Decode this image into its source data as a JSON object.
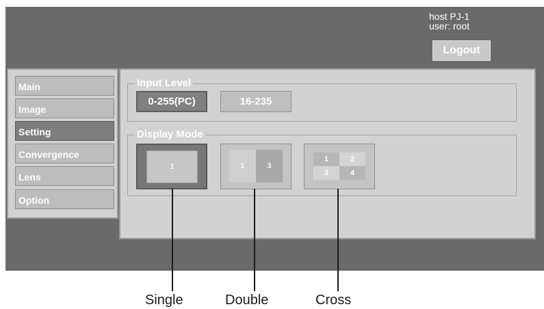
{
  "header": {
    "host_text": "host PJ-1",
    "user_text": "user: root",
    "logout_label": "Logout"
  },
  "sidebar": {
    "items": [
      {
        "label": "Main"
      },
      {
        "label": "Image"
      },
      {
        "label": "Setting",
        "active": true
      },
      {
        "label": "Convergence"
      },
      {
        "label": "Lens"
      },
      {
        "label": "Option"
      }
    ]
  },
  "input_level": {
    "legend": "Input Level",
    "options": [
      {
        "label": "0-255(PC)",
        "selected": true
      },
      {
        "label": "16-235",
        "selected": false
      }
    ]
  },
  "display_mode": {
    "legend": "Display Mode",
    "single": {
      "panes": [
        "1"
      ],
      "selected": true
    },
    "double": {
      "panes": [
        "1",
        "3"
      ],
      "selected": false
    },
    "cross": {
      "panes": [
        "1",
        "2",
        "3",
        "4"
      ],
      "selected": false
    }
  },
  "callouts": {
    "single": "Single",
    "double": "Double",
    "cross": "Cross"
  },
  "colors": {
    "background": "#6a6a6a",
    "panel": "#d2d2d2",
    "selected_button": "#7d7d7d",
    "button": "#bfbfbf"
  }
}
